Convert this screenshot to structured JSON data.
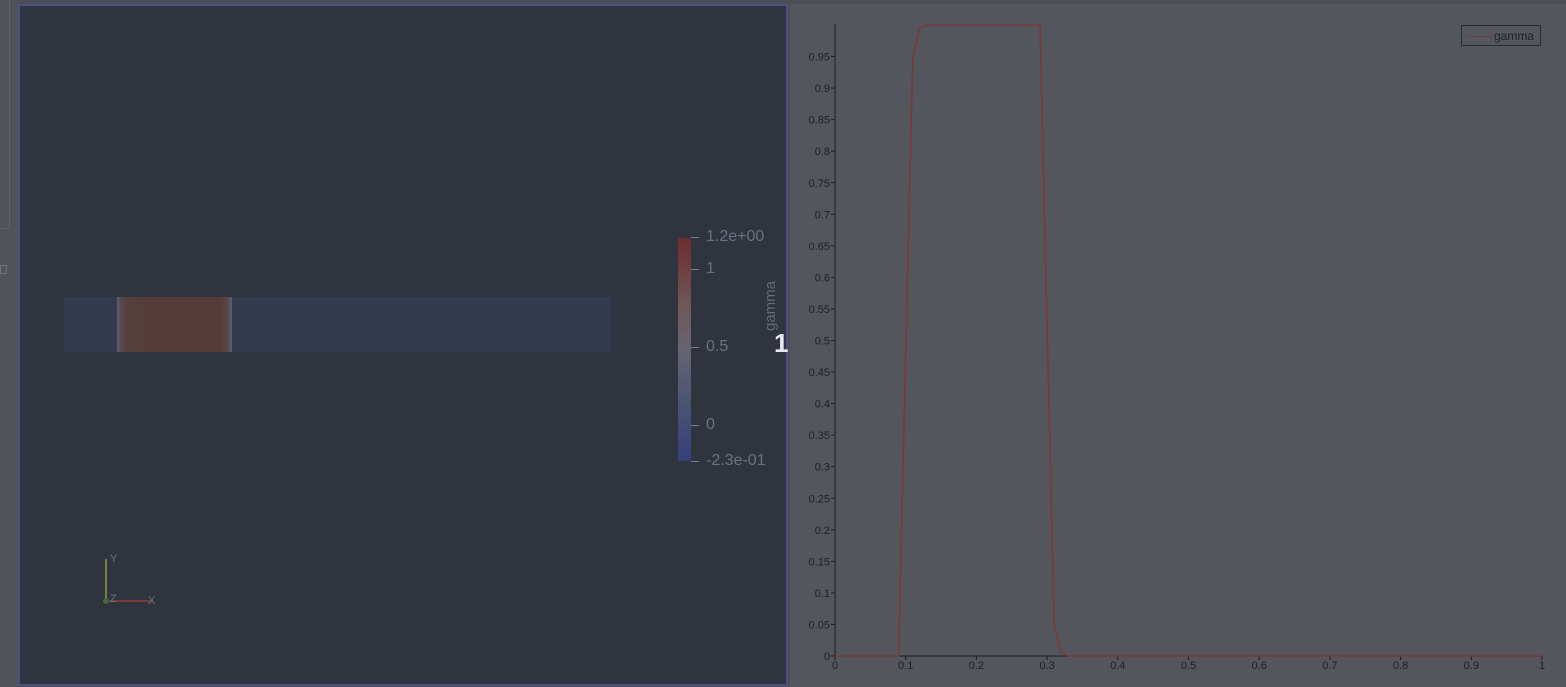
{
  "render_view": {
    "view_number": "1",
    "colorbar": {
      "title": "gamma",
      "labels": [
        "1.2e+00",
        "1",
        "0.5",
        "0",
        "-2.3e-01"
      ]
    },
    "orientation_axes": {
      "y": "Y",
      "z": "Z",
      "x": "X"
    }
  },
  "chart_data": {
    "type": "line",
    "title": "",
    "xlabel": "",
    "ylabel": "",
    "xlim": [
      0,
      1
    ],
    "ylim": [
      0,
      1
    ],
    "grid": false,
    "legend": "top-right",
    "x_ticks": [
      "0",
      "0.1",
      "0.2",
      "0.3",
      "0.4",
      "0.5",
      "0.6",
      "0.7",
      "0.8",
      "0.9",
      "1"
    ],
    "y_ticks": [
      "0",
      "0.05",
      "0.1",
      "0.15",
      "0.2",
      "0.25",
      "0.3",
      "0.35",
      "0.4",
      "0.45",
      "0.5",
      "0.55",
      "0.6",
      "0.65",
      "0.7",
      "0.75",
      "0.8",
      "0.85",
      "0.9",
      "0.95"
    ],
    "series": [
      {
        "name": "gamma",
        "color": "#7a3a38",
        "x": [
          0,
          0.09,
          0.1,
          0.11,
          0.12,
          0.13,
          0.2,
          0.29,
          0.3,
          0.31,
          0.32,
          0.33,
          0.4,
          0.5,
          0.6,
          0.7,
          0.8,
          0.9,
          1
        ],
        "y": [
          0,
          0,
          0.48,
          0.95,
          0.995,
          1.0,
          1.0,
          1.0,
          0.52,
          0.05,
          0.005,
          0,
          0,
          0,
          0,
          0,
          0,
          0,
          0
        ]
      }
    ]
  }
}
